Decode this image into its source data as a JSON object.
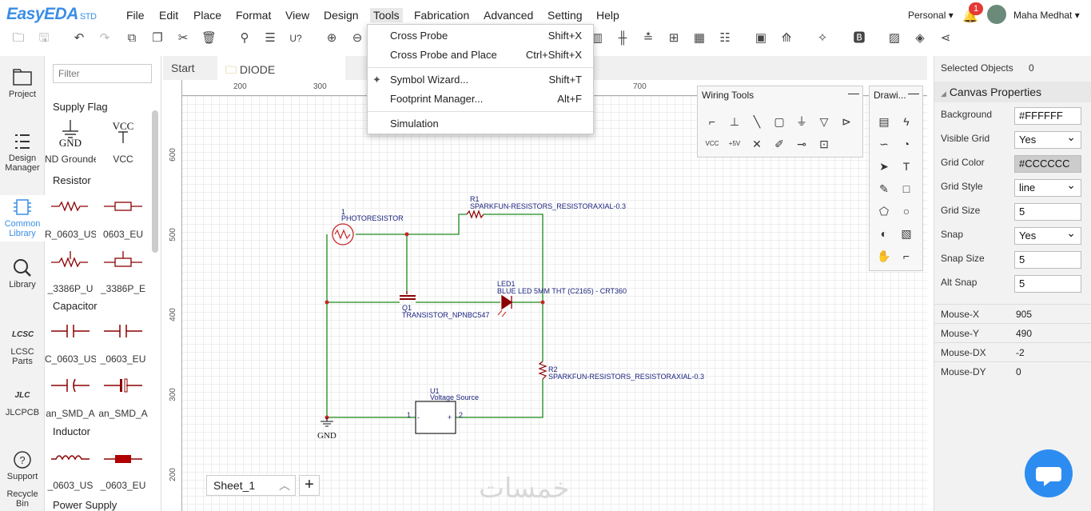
{
  "app": {
    "logo": "EasyEDA",
    "logo_suffix": "STD"
  },
  "menu": [
    "File",
    "Edit",
    "Place",
    "Format",
    "View",
    "Design",
    "Tools",
    "Fabrication",
    "Advanced",
    "Setting",
    "Help"
  ],
  "user": {
    "workspace": "Personal",
    "notifications": "1",
    "name": "Maha Medhat"
  },
  "leftnav": [
    "Project",
    "Design Manager",
    "Common Library",
    "Library",
    "LCSC Parts",
    "JLCPCB",
    "Support",
    "Recycle Bin"
  ],
  "library": {
    "filter_placeholder": "Filter",
    "categories": [
      "Supply Flag",
      "Resistor",
      "Capacitor",
      "Inductor",
      "Power Supply"
    ],
    "items": {
      "supply": [
        "ND Grounde",
        "VCC"
      ],
      "resistor1": [
        "R_0603_US",
        "0603_EU"
      ],
      "resistor2": [
        "_3386P_U",
        "_3386P_E"
      ],
      "capacitor1": [
        "C_0603_US",
        "_0603_EU"
      ],
      "capacitor2": [
        "an_SMD_A",
        "an_SMD_A"
      ],
      "inductor": [
        "_0603_US",
        "_0603_EU"
      ]
    },
    "icons": {
      "gnd": "GND",
      "vcc": "VCC"
    }
  },
  "tabs": {
    "start": "Start",
    "diode": "DIODE"
  },
  "tools_menu": [
    {
      "label": "Cross Probe",
      "shortcut": "Shift+X"
    },
    {
      "label": "Cross Probe and Place",
      "shortcut": "Ctrl+Shift+X"
    },
    {
      "label": "Symbol Wizard...",
      "shortcut": "Shift+T"
    },
    {
      "label": "Footprint Manager...",
      "shortcut": "Alt+F"
    },
    {
      "label": "Simulation",
      "shortcut": ""
    }
  ],
  "ruler": {
    "top": [
      "200",
      "300",
      "700"
    ],
    "left": [
      "600",
      "500",
      "400",
      "300",
      "200"
    ]
  },
  "panels": {
    "wiring": "Wiring Tools",
    "drawing": "Drawi...",
    "vcc": "VCC",
    "p5v": "+5V"
  },
  "schematic": {
    "photoresistor_num": "1",
    "photoresistor": "PHOTORESISTOR",
    "r1_ref": "R1",
    "r1_name": "SPARKFUN-RESISTORS_RESISTORAXIAL-0.3",
    "led_ref": "LED1",
    "led_name": "BLUE LED 5MM THT (C2165) - CRT360",
    "q1_ref": "Q1",
    "q1_name": "TRANSISTOR_NPNBC547",
    "r2_ref": "R2",
    "r2_name": "SPARKFUN-RESISTORS_RESISTORAXIAL-0.3",
    "u1_ref": "U1",
    "u1_name": "Voltage Source",
    "pin1": "1",
    "pin2": "2",
    "minus": "-",
    "plus": "+",
    "gnd": "GND"
  },
  "sheet": {
    "name": "Sheet_1",
    "add": "+"
  },
  "watermark": "خمسات",
  "properties": {
    "selected_label": "Selected Objects",
    "selected_value": "0",
    "section": "Canvas Properties",
    "rows": [
      {
        "label": "Background",
        "value": "#FFFFFF"
      },
      {
        "label": "Visible Grid",
        "value": "Yes"
      },
      {
        "label": "Grid Color",
        "value": "#CCCCCC"
      },
      {
        "label": "Grid Style",
        "value": "line"
      },
      {
        "label": "Grid Size",
        "value": "5"
      },
      {
        "label": "Snap",
        "value": "Yes"
      },
      {
        "label": "Snap Size",
        "value": "5"
      },
      {
        "label": "Alt Snap",
        "value": "5"
      }
    ],
    "mouse": [
      {
        "label": "Mouse-X",
        "value": "905"
      },
      {
        "label": "Mouse-Y",
        "value": "490"
      },
      {
        "label": "Mouse-DX",
        "value": "-2"
      },
      {
        "label": "Mouse-DY",
        "value": "0"
      }
    ]
  },
  "colors": {
    "brand": "#3a8ee6",
    "wire": "#1a8a1a",
    "part": "#8b0000",
    "label": "#1a237e",
    "chat": "#2d8cf0"
  }
}
